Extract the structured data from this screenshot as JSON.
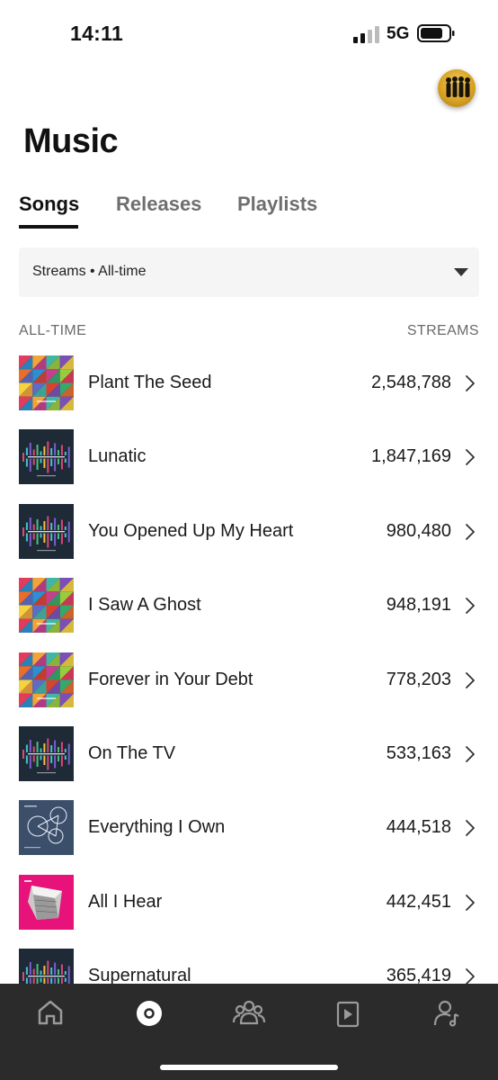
{
  "status": {
    "time": "14:11",
    "network": "5G"
  },
  "header": {
    "title": "Music"
  },
  "tabs": [
    {
      "label": "Songs",
      "active": true
    },
    {
      "label": "Releases",
      "active": false
    },
    {
      "label": "Playlists",
      "active": false
    }
  ],
  "filter": {
    "label": "Streams • All-time"
  },
  "list_header": {
    "left": "ALL-TIME",
    "right": "STREAMS"
  },
  "songs": [
    {
      "title": "Plant The Seed",
      "streams": "2,548,788",
      "art": "colorful-cubes"
    },
    {
      "title": "Lunatic",
      "streams": "1,847,169",
      "art": "build-a-tower"
    },
    {
      "title": "You Opened Up My Heart",
      "streams": "980,480",
      "art": "build-a-tower"
    },
    {
      "title": "I Saw A Ghost",
      "streams": "948,191",
      "art": "colorful-cubes"
    },
    {
      "title": "Forever in Your Debt",
      "streams": "778,203",
      "art": "colorful-cubes"
    },
    {
      "title": "On The TV",
      "streams": "533,163",
      "art": "build-a-tower"
    },
    {
      "title": "Everything I Own",
      "streams": "444,518",
      "art": "circles-diagram"
    },
    {
      "title": "All I Hear",
      "streams": "442,451",
      "art": "pink-structure"
    },
    {
      "title": "Supernatural",
      "streams": "365,419",
      "art": "build-a-tower"
    }
  ],
  "nav": [
    {
      "icon": "home-icon",
      "active": false
    },
    {
      "icon": "music-disc-icon",
      "active": true
    },
    {
      "icon": "audience-icon",
      "active": false
    },
    {
      "icon": "video-icon",
      "active": false
    },
    {
      "icon": "profile-music-icon",
      "active": false
    }
  ],
  "colors": {
    "nav_bg": "#2b2b2b",
    "accent": "#111111",
    "filter_bg": "#f5f5f5"
  }
}
